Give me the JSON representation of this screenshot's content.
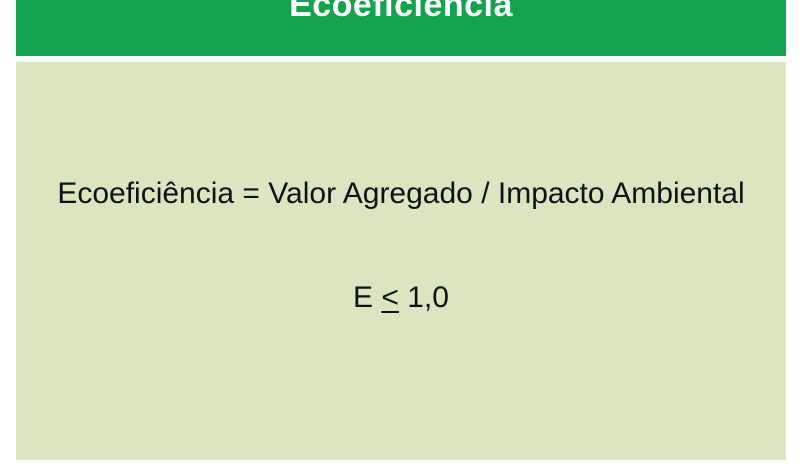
{
  "slide": {
    "title": "Ecoeficiência",
    "formula": "Ecoeficiência = Valor Agregado / Impacto Ambiental",
    "inequality": {
      "variable": "E",
      "operator": "<",
      "value": "1,0"
    }
  },
  "colors": {
    "title_bar": "#12a34c",
    "title_text": "#ffffff",
    "content_background": "#d9e6bf",
    "body_text": "#111111"
  }
}
